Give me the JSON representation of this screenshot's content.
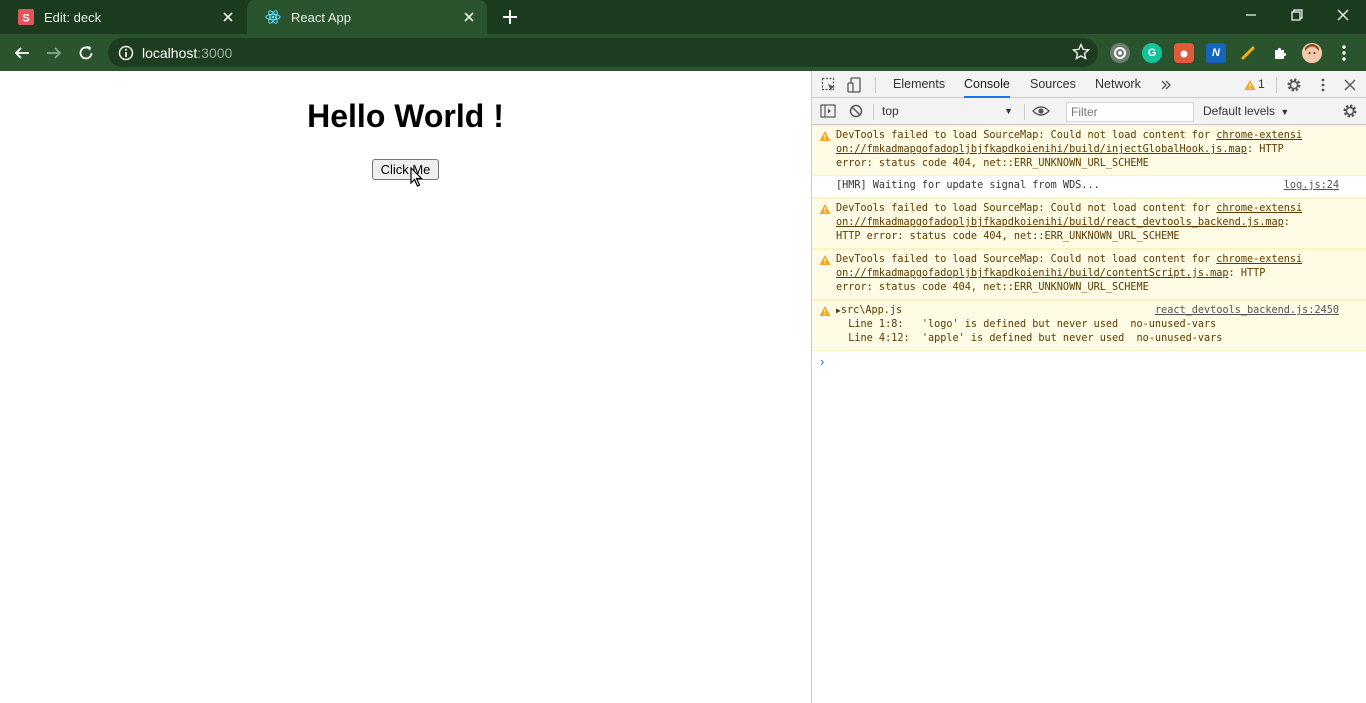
{
  "browser": {
    "tabs": [
      {
        "title": "Edit: deck",
        "favicon": "slides-icon",
        "active": false
      },
      {
        "title": "React App",
        "favicon": "react-icon",
        "active": true
      }
    ],
    "url_host": "localhost",
    "url_port": ":3000",
    "colors": {
      "frame": "#1b3b1e",
      "toolbar": "#2a542d",
      "omnibox": "#1d3c20"
    }
  },
  "page": {
    "heading": "Hello World !",
    "button_label": "Click Me"
  },
  "devtools": {
    "tabs": [
      "Elements",
      "Console",
      "Sources",
      "Network"
    ],
    "selected_tab": "Console",
    "warning_count": "1",
    "context": "top",
    "filter_placeholder": "Filter",
    "levels": "Default levels",
    "messages": [
      {
        "level": "warning",
        "lines": [
          "DevTools failed to load SourceMap: Could not load content for ",
          "chrome-extensi",
          "on://fmkadmapgofadopljbjfkapdkoienihi/build/injectGlobalHook.js.map",
          ": HTTP",
          "error: status code 404, net::ERR_UNKNOWN_URL_SCHEME"
        ]
      },
      {
        "level": "info",
        "text": "[HMR] Waiting for update signal from WDS...",
        "source": "log.js:24"
      },
      {
        "level": "warning",
        "lines": [
          "DevTools failed to load SourceMap: Could not load content for ",
          "chrome-extensi",
          "on://fmkadmapgofadopljbjfkapdkoienihi/build/react_devtools_backend.js.map",
          ":",
          "HTTP error: status code 404, net::ERR_UNKNOWN_URL_SCHEME"
        ]
      },
      {
        "level": "warning",
        "lines": [
          "DevTools failed to load SourceMap: Could not load content for ",
          "chrome-extensi",
          "on://fmkadmapgofadopljbjfkapdkoienihi/build/contentScript.js.map",
          ": HTTP",
          "error: status code 404, net::ERR_UNKNOWN_URL_SCHEME"
        ]
      },
      {
        "level": "warning",
        "file": "src\\App.js",
        "source": "react_devtools_backend.js:2450",
        "details": [
          "  Line 1:8:   'logo' is defined but never used  no-unused-vars",
          "  Line 4:12:  'apple' is defined but never used  no-unused-vars"
        ]
      }
    ],
    "prompt": "›"
  }
}
